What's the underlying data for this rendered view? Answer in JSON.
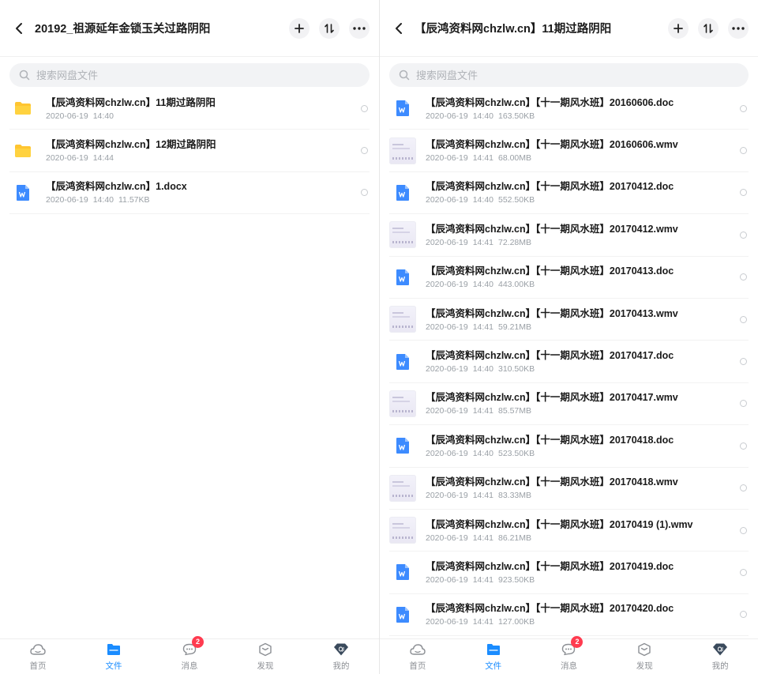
{
  "search_placeholder": "搜索网盘文件",
  "tabs": [
    {
      "label": "首页"
    },
    {
      "label": "文件"
    },
    {
      "label": "消息",
      "badge": "2"
    },
    {
      "label": "发现"
    },
    {
      "label": "我的"
    }
  ],
  "left": {
    "title": "20192_祖源延年金锁玉关过路阴阳",
    "items": [
      {
        "name": "【辰鸿资料网chzlw.cn】11期过路阴阳",
        "date": "2020-06-19",
        "time": "14:40",
        "size": ""
      },
      {
        "name": "【辰鸿资料网chzlw.cn】12期过路阴阳",
        "date": "2020-06-19",
        "time": "14:44",
        "size": ""
      },
      {
        "name": "【辰鸿资料网chzlw.cn】1.docx",
        "date": "2020-06-19",
        "time": "14:40",
        "size": "11.57KB"
      }
    ]
  },
  "right": {
    "title": "【辰鸿资料网chzlw.cn】11期过路阴阳",
    "items": [
      {
        "name": "【辰鸿资料网chzlw.cn】【十一期风水班】20160606.doc",
        "date": "2020-06-19",
        "time": "14:40",
        "size": "163.50KB"
      },
      {
        "name": "【辰鸿资料网chzlw.cn】【十一期风水班】20160606.wmv",
        "date": "2020-06-19",
        "time": "14:41",
        "size": "68.00MB"
      },
      {
        "name": "【辰鸿资料网chzlw.cn】【十一期风水班】20170412.doc",
        "date": "2020-06-19",
        "time": "14:40",
        "size": "552.50KB"
      },
      {
        "name": "【辰鸿资料网chzlw.cn】【十一期风水班】20170412.wmv",
        "date": "2020-06-19",
        "time": "14:41",
        "size": "72.28MB"
      },
      {
        "name": "【辰鸿资料网chzlw.cn】【十一期风水班】20170413.doc",
        "date": "2020-06-19",
        "time": "14:40",
        "size": "443.00KB"
      },
      {
        "name": "【辰鸿资料网chzlw.cn】【十一期风水班】20170413.wmv",
        "date": "2020-06-19",
        "time": "14:41",
        "size": "59.21MB"
      },
      {
        "name": "【辰鸿资料网chzlw.cn】【十一期风水班】20170417.doc",
        "date": "2020-06-19",
        "time": "14:40",
        "size": "310.50KB"
      },
      {
        "name": "【辰鸿资料网chzlw.cn】【十一期风水班】20170417.wmv",
        "date": "2020-06-19",
        "time": "14:41",
        "size": "85.57MB"
      },
      {
        "name": "【辰鸿资料网chzlw.cn】【十一期风水班】20170418.doc",
        "date": "2020-06-19",
        "time": "14:40",
        "size": "523.50KB"
      },
      {
        "name": "【辰鸿资料网chzlw.cn】【十一期风水班】20170418.wmv",
        "date": "2020-06-19",
        "time": "14:41",
        "size": "83.33MB"
      },
      {
        "name": "【辰鸿资料网chzlw.cn】【十一期风水班】20170419 (1).wmv",
        "date": "2020-06-19",
        "time": "14:41",
        "size": "86.21MB"
      },
      {
        "name": "【辰鸿资料网chzlw.cn】【十一期风水班】20170419.doc",
        "date": "2020-06-19",
        "time": "14:41",
        "size": "923.50KB"
      },
      {
        "name": "【辰鸿资料网chzlw.cn】【十一期风水班】20170420.doc",
        "date": "2020-06-19",
        "time": "14:41",
        "size": "127.00KB"
      }
    ]
  }
}
